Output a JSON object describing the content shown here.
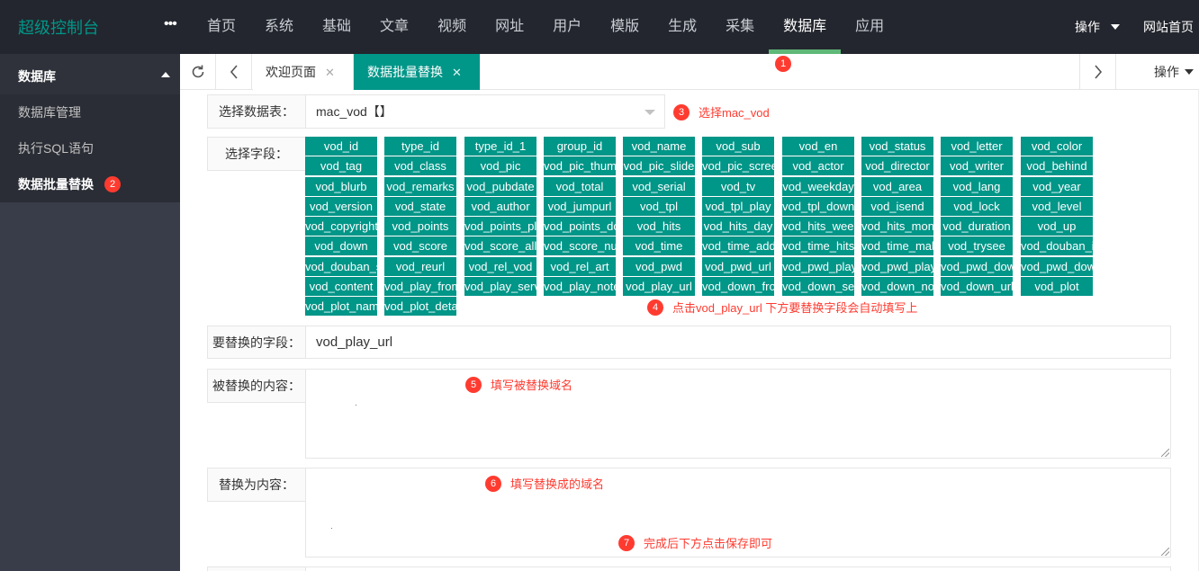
{
  "app": {
    "title": "超级控制台",
    "more": "•••"
  },
  "nav": {
    "items": [
      "首页",
      "系统",
      "基础",
      "文章",
      "视频",
      "网址",
      "用户",
      "模版",
      "生成",
      "采集",
      "数据库",
      "应用"
    ],
    "active": "数据库"
  },
  "topright": {
    "operate": "操作",
    "home": "网站首页"
  },
  "sidebar": {
    "group": "数据库",
    "items": [
      "数据库管理",
      "执行SQL语句",
      "数据批量替换"
    ],
    "active": "数据批量替换"
  },
  "tabs": {
    "items": [
      {
        "label": "欢迎页面",
        "close": "✕"
      },
      {
        "label": "数据批量替换",
        "close": "✕"
      }
    ],
    "active": "数据批量替换",
    "operate": "操作"
  },
  "form": {
    "table_label": "选择数据表：",
    "table_value": "mac_vod【】",
    "fields_label": "选择字段：",
    "fields": [
      "vod_id",
      "type_id",
      "type_id_1",
      "group_id",
      "vod_name",
      "vod_sub",
      "vod_en",
      "vod_status",
      "vod_letter",
      "vod_color",
      "vod_tag",
      "vod_class",
      "vod_pic",
      "vod_pic_thumb",
      "vod_pic_slide",
      "vod_pic_screenshot",
      "vod_actor",
      "vod_director",
      "vod_writer",
      "vod_behind",
      "vod_blurb",
      "vod_remarks",
      "vod_pubdate",
      "vod_total",
      "vod_serial",
      "vod_tv",
      "vod_weekday",
      "vod_area",
      "vod_lang",
      "vod_year",
      "vod_version",
      "vod_state",
      "vod_author",
      "vod_jumpurl",
      "vod_tpl",
      "vod_tpl_play",
      "vod_tpl_down",
      "vod_isend",
      "vod_lock",
      "vod_level",
      "vod_copyright",
      "vod_points",
      "vod_points_play",
      "vod_points_down",
      "vod_hits",
      "vod_hits_day",
      "vod_hits_week",
      "vod_hits_month",
      "vod_duration",
      "vod_up",
      "vod_down",
      "vod_score",
      "vod_score_all",
      "vod_score_num",
      "vod_time",
      "vod_time_add",
      "vod_time_hits",
      "vod_time_make",
      "vod_trysee",
      "vod_douban_id",
      "vod_douban_score",
      "vod_reurl",
      "vod_rel_vod",
      "vod_rel_art",
      "vod_pwd",
      "vod_pwd_url",
      "vod_pwd_play",
      "vod_pwd_play_url",
      "vod_pwd_down",
      "vod_pwd_down_url",
      "vod_content",
      "vod_play_from",
      "vod_play_server",
      "vod_play_note",
      "vod_play_url",
      "vod_down_from",
      "vod_down_server",
      "vod_down_note",
      "vod_down_url",
      "vod_plot",
      "vod_plot_name",
      "vod_plot_detail"
    ],
    "replace_field_label": "要替换的字段：",
    "replace_field_value": "vod_play_url",
    "replaced_content_label": "被替换的内容：",
    "replace_to_label": "替换为内容："
  },
  "annotations": [
    {
      "num": "1",
      "text": ""
    },
    {
      "num": "2",
      "text": ""
    },
    {
      "num": "3",
      "text": "选择mac_vod"
    },
    {
      "num": "4",
      "text": "点击vod_play_url 下方要替换字段会自动填写上"
    },
    {
      "num": "5",
      "text": "填写被替换域名"
    },
    {
      "num": "6",
      "text": "填写替换成的域名"
    },
    {
      "num": "7",
      "text": "完成后下方点击保存即可"
    }
  ],
  "colors": {
    "topbar": "#23262e",
    "sidebar": "#393d49",
    "accent": "#009688",
    "nav_active_bar": "#5fb878",
    "annotation": "#ff3b30"
  }
}
